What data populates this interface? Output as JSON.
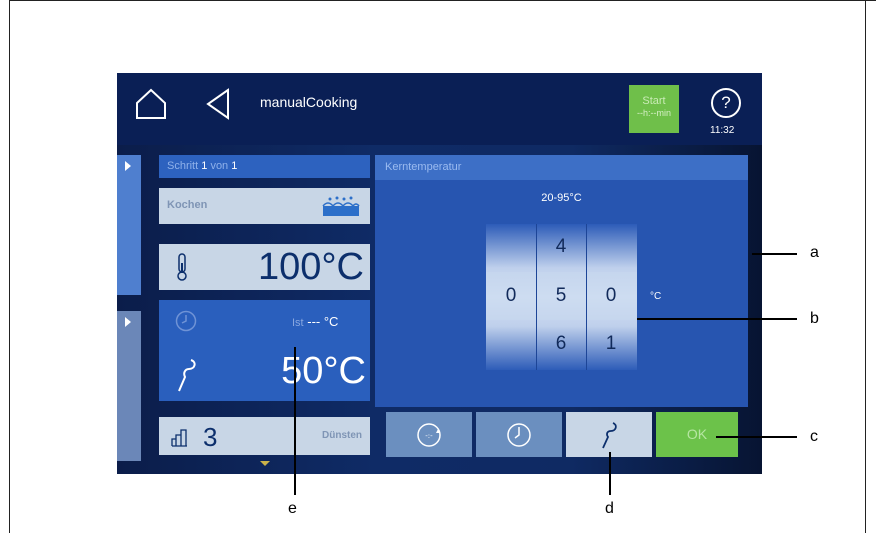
{
  "header": {
    "title": "manualCooking",
    "start_label": "Start",
    "start_time": "--h:--min",
    "help_symbol": "?",
    "clock": "11:32"
  },
  "left": {
    "step_prefix": "Schritt",
    "step_current": "1",
    "step_of": "von",
    "step_total": "1",
    "mode": "Kochen",
    "cabinet_temp": "100°C",
    "core_actual_prefix": "Ist",
    "core_actual_value": "--- °C",
    "core_target": "50°C",
    "fan_level": "3",
    "fan_mode": "Dünsten"
  },
  "right": {
    "header": "Kerntemperatur",
    "range": "20-95°C",
    "picker": {
      "top": [
        "",
        "4",
        ""
      ],
      "middle": [
        "0",
        "5",
        "0"
      ],
      "bottom": [
        "",
        "6",
        "1"
      ]
    },
    "unit": "°C",
    "ok_label": "OK"
  },
  "callouts": [
    "a",
    "b",
    "c",
    "d",
    "e"
  ],
  "colors": {
    "accent_green": "#6cc24a",
    "panel_blue": "#2755b0",
    "header_blue": "#0a1f55"
  }
}
